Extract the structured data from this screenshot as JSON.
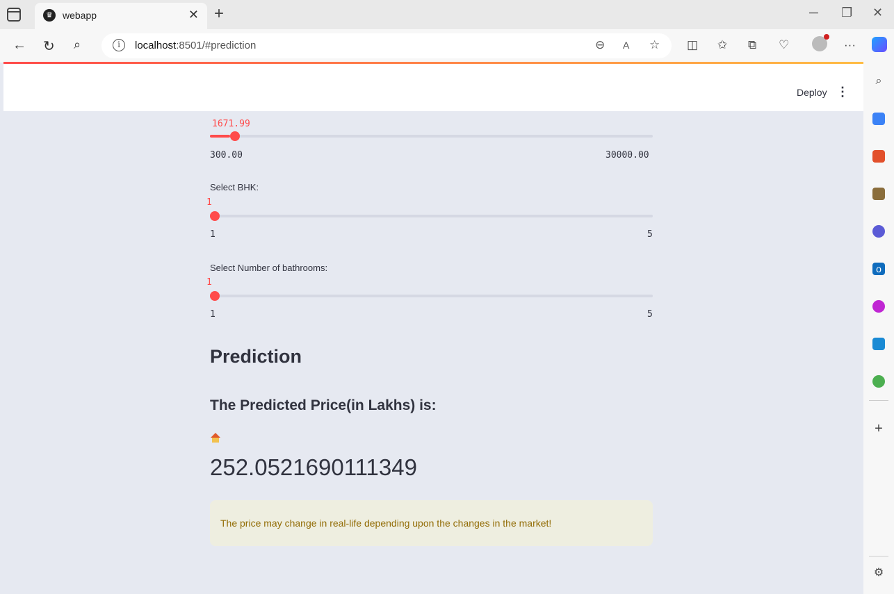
{
  "browser": {
    "tab_title": "webapp",
    "url_host": "localhost",
    "url_rest": ":8501/#prediction"
  },
  "header": {
    "deploy_label": "Deploy"
  },
  "sliders": [
    {
      "label": "",
      "value_text": "1671.99",
      "min_text": "300.00",
      "max_text": "30000.00",
      "value": 1671.99,
      "min": 300,
      "max": 30000
    },
    {
      "label": "Select BHK:",
      "value_text": "1",
      "min_text": "1",
      "max_text": "5",
      "value": 1,
      "min": 1,
      "max": 5
    },
    {
      "label": "Select Number of bathrooms:",
      "value_text": "1",
      "min_text": "1",
      "max_text": "5",
      "value": 1,
      "min": 1,
      "max": 5
    }
  ],
  "prediction": {
    "heading": "Prediction",
    "subheading": "The Predicted Price(in Lakhs) is:",
    "value": "252.0521690111349",
    "warning": "The price may change in real-life depending upon the changes in the market!"
  },
  "colors": {
    "accent": "#ff4b4b",
    "background": "#e6e9f1",
    "warning_bg": "#eeeee0",
    "warning_text": "#926c05"
  }
}
